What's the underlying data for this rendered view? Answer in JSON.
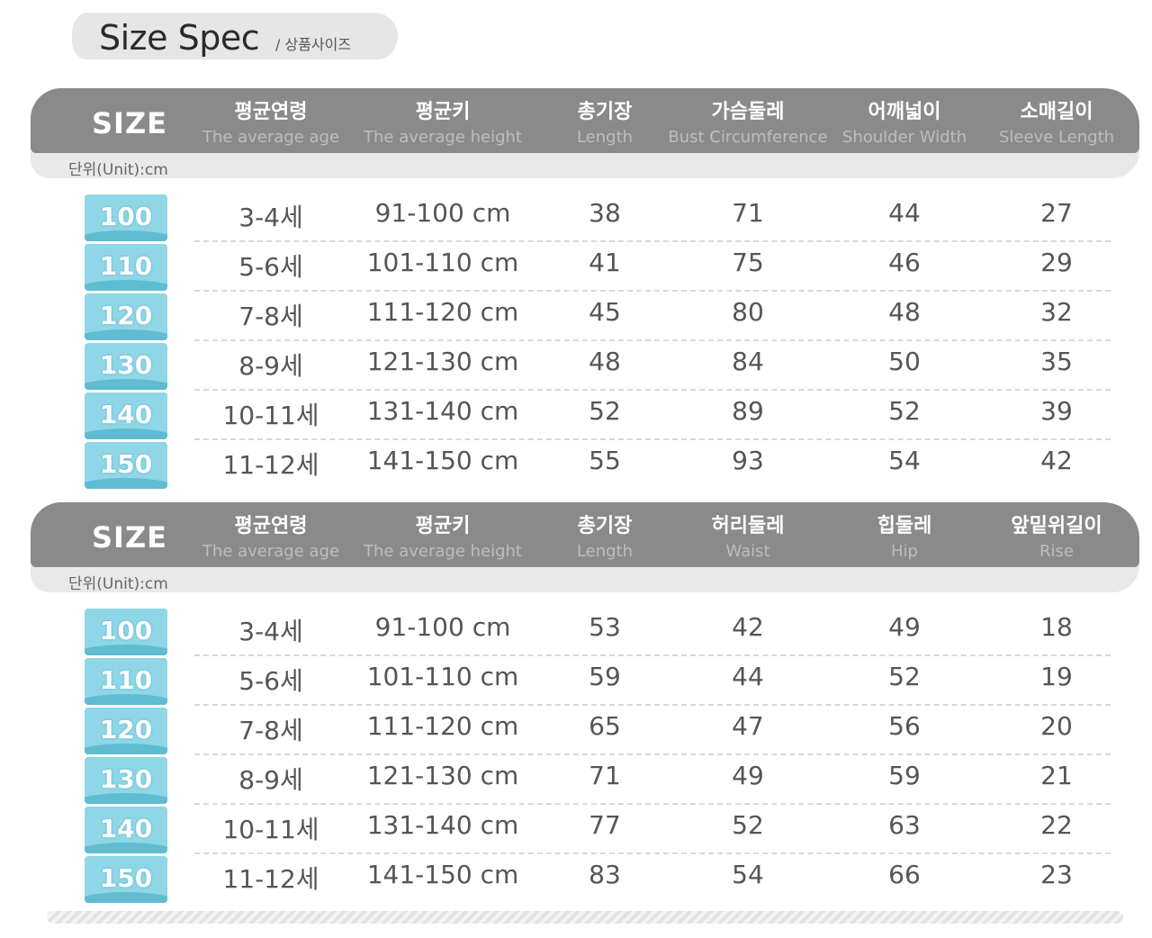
{
  "title": {
    "main": "Size Spec",
    "sub": "/ 상품사이즈"
  },
  "sections": [
    {
      "size_label": "SIZE",
      "unit": "단위(Unit):cm",
      "columns": [
        {
          "ko": "평균연령",
          "en": "The average age"
        },
        {
          "ko": "평균키",
          "en": "The average height"
        },
        {
          "ko": "총기장",
          "en": "Length"
        },
        {
          "ko": "가슴둘레",
          "en": "Bust Circumference"
        },
        {
          "ko": "어깨넓이",
          "en": "Shoulder Width"
        },
        {
          "ko": "소매길이",
          "en": "Sleeve Length"
        }
      ],
      "rows": [
        {
          "size": "100",
          "cells": [
            "3-4세",
            "91-100 cm",
            "38",
            "71",
            "44",
            "27"
          ]
        },
        {
          "size": "110",
          "cells": [
            "5-6세",
            "101-110 cm",
            "41",
            "75",
            "46",
            "29"
          ]
        },
        {
          "size": "120",
          "cells": [
            "7-8세",
            "111-120 cm",
            "45",
            "80",
            "48",
            "32"
          ]
        },
        {
          "size": "130",
          "cells": [
            "8-9세",
            "121-130 cm",
            "48",
            "84",
            "50",
            "35"
          ]
        },
        {
          "size": "140",
          "cells": [
            "10-11세",
            "131-140 cm",
            "52",
            "89",
            "52",
            "39"
          ]
        },
        {
          "size": "150",
          "cells": [
            "11-12세",
            "141-150 cm",
            "55",
            "93",
            "54",
            "42"
          ]
        }
      ]
    },
    {
      "size_label": "SIZE",
      "unit": "단위(Unit):cm",
      "columns": [
        {
          "ko": "평균연령",
          "en": "The average age"
        },
        {
          "ko": "평균키",
          "en": "The average height"
        },
        {
          "ko": "총기장",
          "en": "Length"
        },
        {
          "ko": "허리둘레",
          "en": "Waist"
        },
        {
          "ko": "힙둘레",
          "en": "Hip"
        },
        {
          "ko": "앞밑위길이",
          "en": "Rise"
        }
      ],
      "rows": [
        {
          "size": "100",
          "cells": [
            "3-4세",
            "91-100 cm",
            "53",
            "42",
            "49",
            "18"
          ]
        },
        {
          "size": "110",
          "cells": [
            "5-6세",
            "101-110 cm",
            "59",
            "44",
            "52",
            "19"
          ]
        },
        {
          "size": "120",
          "cells": [
            "7-8세",
            "111-120 cm",
            "65",
            "47",
            "56",
            "20"
          ]
        },
        {
          "size": "130",
          "cells": [
            "8-9세",
            "121-130 cm",
            "71",
            "49",
            "59",
            "21"
          ]
        },
        {
          "size": "140",
          "cells": [
            "10-11세",
            "131-140 cm",
            "77",
            "52",
            "63",
            "22"
          ]
        },
        {
          "size": "150",
          "cells": [
            "11-12세",
            "141-150 cm",
            "83",
            "54",
            "66",
            "23"
          ]
        }
      ]
    }
  ]
}
